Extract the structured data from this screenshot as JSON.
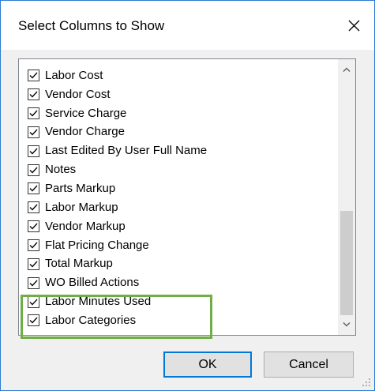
{
  "dialog": {
    "title": "Select Columns to Show",
    "close_icon": "close-icon"
  },
  "columns": [
    {
      "label": "Labor Cost",
      "checked": true
    },
    {
      "label": "Vendor Cost",
      "checked": true
    },
    {
      "label": "Service Charge",
      "checked": true
    },
    {
      "label": "Vendor Charge",
      "checked": true
    },
    {
      "label": "Last Edited By User Full Name",
      "checked": true
    },
    {
      "label": "Notes",
      "checked": true
    },
    {
      "label": "Parts Markup",
      "checked": true
    },
    {
      "label": "Labor Markup",
      "checked": true
    },
    {
      "label": "Vendor Markup",
      "checked": true
    },
    {
      "label": "Flat Pricing Change",
      "checked": true
    },
    {
      "label": "Total Markup",
      "checked": true
    },
    {
      "label": "WO Billed Actions",
      "checked": true
    },
    {
      "label": "Labor Minutes Used",
      "checked": true
    },
    {
      "label": "Labor Categories",
      "checked": true
    }
  ],
  "buttons": {
    "ok_label": "OK",
    "cancel_label": "Cancel"
  },
  "colors": {
    "window_border": "#2b7cd3",
    "highlight": "#70ad47",
    "default_button_border": "#0078d7"
  },
  "icons": {
    "close": "close-icon",
    "checkbox": "checkmark-icon",
    "scroll_up": "chevron-up-icon",
    "scroll_down": "chevron-down-icon",
    "resize": "resize-grip-icon"
  }
}
